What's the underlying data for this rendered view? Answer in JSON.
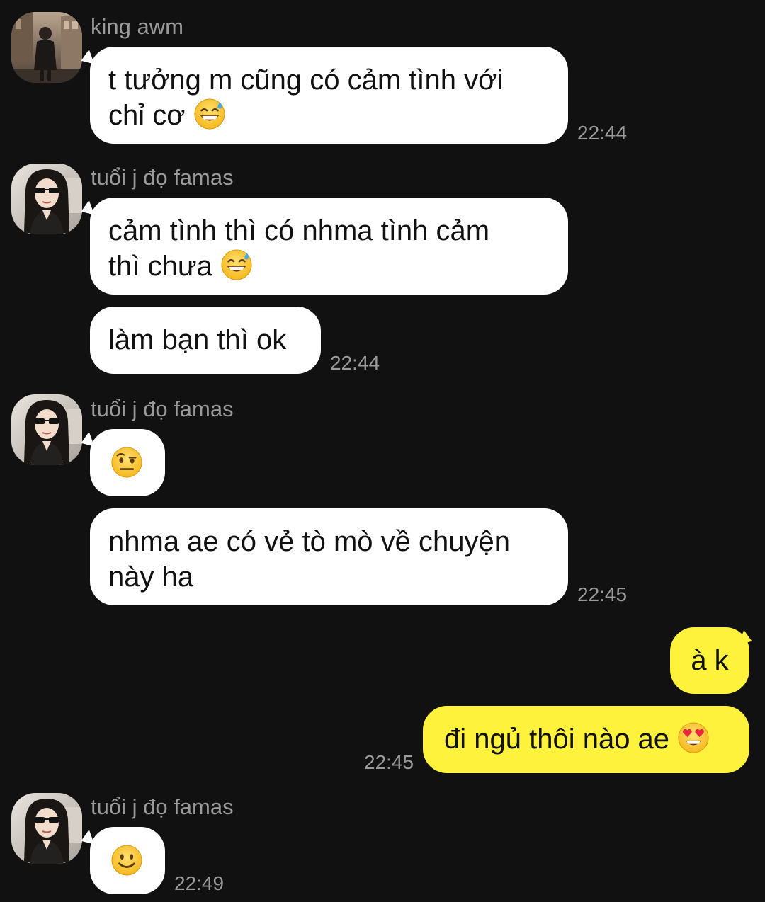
{
  "colors": {
    "background": "#111111",
    "incoming_bubble": "#ffffff",
    "outgoing_bubble": "#fff23c",
    "meta_text": "#9a9a9a"
  },
  "messages": [
    {
      "sender": "king awm",
      "lines": [
        "t tưởng m cũng có cảm tình với",
        "chỉ cơ"
      ],
      "emoji": "grinning-sweat-emoji",
      "time": "22:44"
    },
    {
      "sender": "tuổi j đọ famas",
      "lines": [
        "cảm tình thì có nhma tình cảm",
        "thì chưa"
      ],
      "emoji": "grinning-sweat-emoji"
    },
    {
      "lines": [
        "làm bạn thì ok"
      ],
      "time": "22:44"
    },
    {
      "sender": "tuổi j đọ famas",
      "emoji": "raised-eyebrow-emoji"
    },
    {
      "lines": [
        "nhma ae có vẻ tò mò về chuyện",
        "này ha"
      ],
      "time": "22:45"
    },
    {
      "lines": [
        "à k"
      ]
    },
    {
      "lines": [
        "đi ngủ thôi nào ae"
      ],
      "emoji": "heart-eyes-emoji",
      "time": "22:45"
    },
    {
      "sender": "tuổi j đọ famas",
      "emoji": "slightly-smiling-emoji",
      "time": "22:49"
    }
  ]
}
